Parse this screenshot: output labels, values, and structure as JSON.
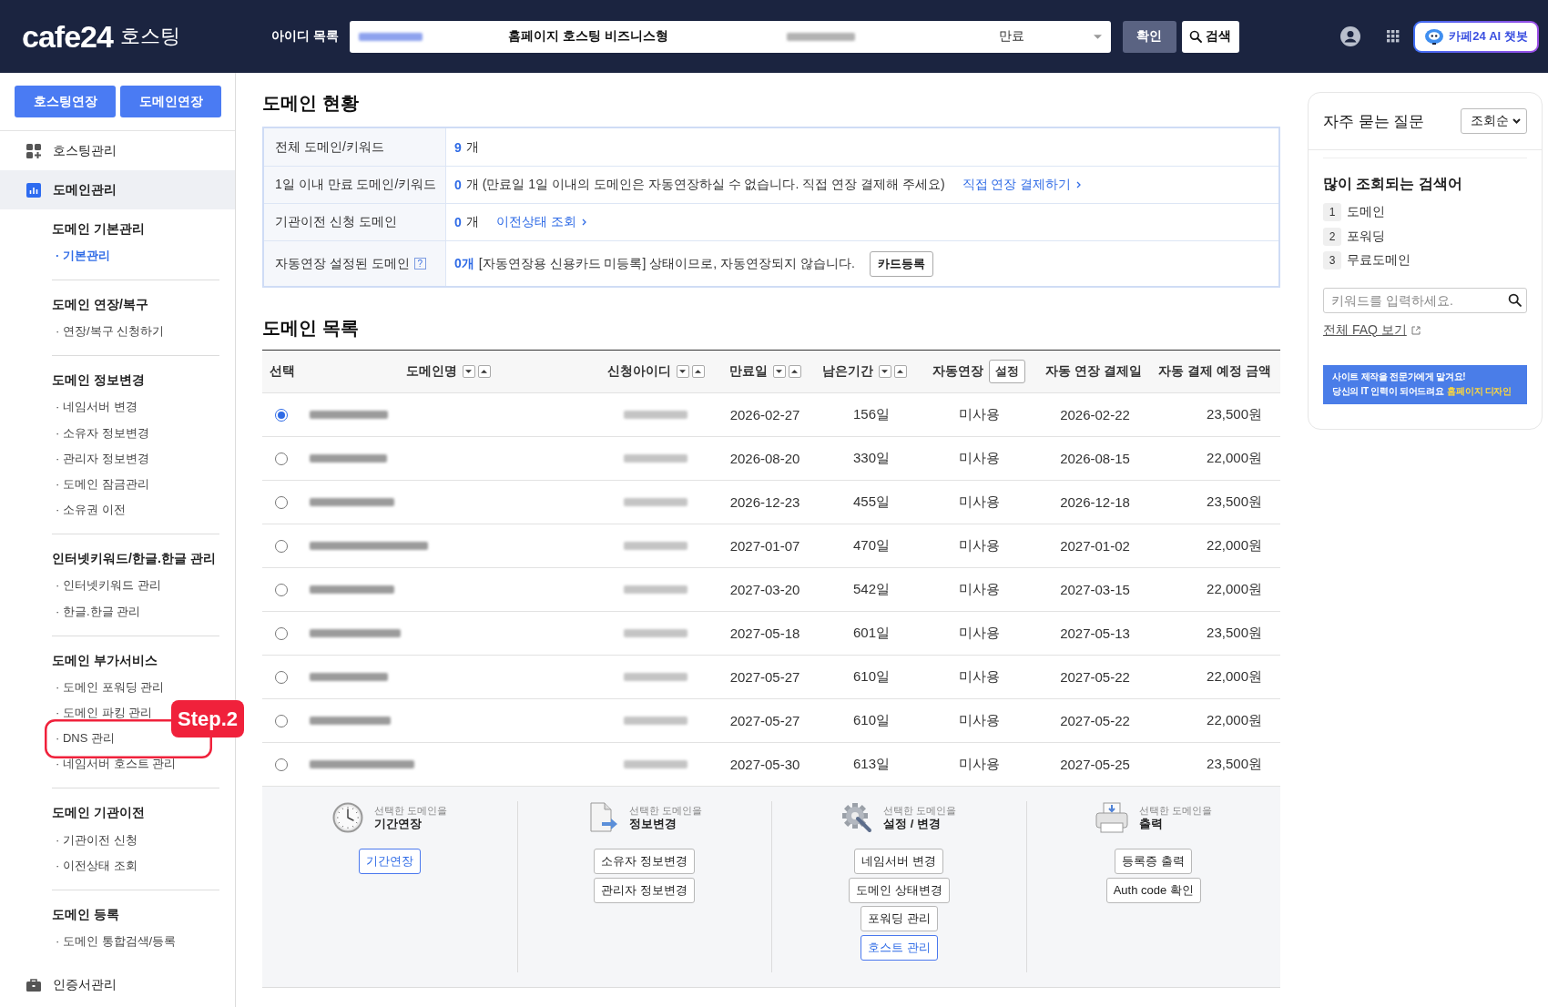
{
  "header": {
    "logo": "cafe24",
    "logo_suffix": "호스팅",
    "account_label": "아이디 목록",
    "account_select": {
      "product": "홈페이지 호스팅 비즈니스형",
      "status": "만료"
    },
    "confirm_button": "확인",
    "search_button": "검색",
    "chatbot_button": "카페24 AI 챗봇"
  },
  "sidebar": {
    "buttons": [
      "호스팅연장",
      "도메인연장"
    ],
    "menu": [
      {
        "label": "호스팅관리",
        "selected": false
      },
      {
        "label": "도메인관리",
        "selected": true,
        "groups": [
          {
            "title": "도메인 기본관리",
            "items": [
              {
                "label": "· 기본관리",
                "selected": true
              }
            ]
          },
          {
            "title": "도메인 연장/복구",
            "items": [
              {
                "label": "· 연장/복구 신청하기",
                "selected": false
              }
            ]
          },
          {
            "title": "도메인 정보변경",
            "items": [
              {
                "label": "· 네임서버 변경",
                "selected": false
              },
              {
                "label": "· 소유자 정보변경",
                "selected": false
              },
              {
                "label": "· 관리자 정보변경",
                "selected": false
              },
              {
                "label": "· 도메인 잠금관리",
                "selected": false
              },
              {
                "label": "· 소유권 이전",
                "selected": false
              }
            ]
          },
          {
            "title": "인터넷키워드/한글.한글 관리",
            "items": [
              {
                "label": "· 인터넷키워드 관리",
                "selected": false
              },
              {
                "label": "· 한글.한글 관리",
                "selected": false
              }
            ]
          },
          {
            "title": "도메인 부가서비스",
            "items": [
              {
                "label": "· 도메인 포워딩 관리",
                "selected": false
              },
              {
                "label": "· 도메인 파킹 관리",
                "selected": false
              },
              {
                "label": "· DNS 관리",
                "selected": false,
                "annotation": "Step.2"
              },
              {
                "label": "· 네임서버 호스트 관리",
                "selected": false
              }
            ]
          },
          {
            "title": "도메인 기관이전",
            "items": [
              {
                "label": "· 기관이전 신청",
                "selected": false
              },
              {
                "label": "· 이전상태 조회",
                "selected": false
              }
            ]
          },
          {
            "title": "도메인 등록",
            "items": [
              {
                "label": "· 도메인 통합검색/등록",
                "selected": false
              }
            ]
          }
        ]
      },
      {
        "label": "인증서관리",
        "selected": false
      }
    ]
  },
  "status": {
    "title": "도메인 현황",
    "rows": [
      {
        "label": "전체 도메인/키워드",
        "count": "9",
        "text": "개"
      },
      {
        "label": "1일 이내 만료 도메인/키워드",
        "count": "0",
        "text": "개 (만료일 1일 이내의 도메인은 자동연장하실 수 없습니다. 직접 연장 결제해 주세요)",
        "link": "직접 연장 결제하기"
      },
      {
        "label": "기관이전 신청 도메인",
        "count": "0",
        "text": "개",
        "link": "이전상태 조회"
      },
      {
        "label": "자동연장 설정된 도메인",
        "help": "?",
        "count": "0개",
        "text": "[자동연장용 신용카드 미등록] 상태이므로, 자동연장되지 않습니다.",
        "button": "카드등록"
      }
    ]
  },
  "domains": {
    "title": "도메인 목록",
    "columns": [
      {
        "label": "선택",
        "sortable": false
      },
      {
        "label": "도메인명",
        "sortable": true
      },
      {
        "label": "신청아이디",
        "sortable": true
      },
      {
        "label": "만료일",
        "sortable": true
      },
      {
        "label": "남은기간",
        "sortable": true
      },
      {
        "label": "자동연장",
        "sortable": false,
        "button": "설정"
      },
      {
        "label": "자동 연장 결제일",
        "sortable": false
      },
      {
        "label": "자동 결제 예정 금액",
        "sortable": false
      }
    ],
    "rows": [
      {
        "selected": true,
        "expires": "2026-02-27",
        "remaining": "156일",
        "auto_renew": "미사용",
        "payment_date": "2026-02-22",
        "amount": "23,500원"
      },
      {
        "selected": false,
        "expires": "2026-08-20",
        "remaining": "330일",
        "auto_renew": "미사용",
        "payment_date": "2026-08-15",
        "amount": "22,000원"
      },
      {
        "selected": false,
        "expires": "2026-12-23",
        "remaining": "455일",
        "auto_renew": "미사용",
        "payment_date": "2026-12-18",
        "amount": "23,500원"
      },
      {
        "selected": false,
        "expires": "2027-01-07",
        "remaining": "470일",
        "auto_renew": "미사용",
        "payment_date": "2027-01-02",
        "amount": "22,000원"
      },
      {
        "selected": false,
        "expires": "2027-03-20",
        "remaining": "542일",
        "auto_renew": "미사용",
        "payment_date": "2027-03-15",
        "amount": "22,000원"
      },
      {
        "selected": false,
        "expires": "2027-05-18",
        "remaining": "601일",
        "auto_renew": "미사용",
        "payment_date": "2027-05-13",
        "amount": "23,500원"
      },
      {
        "selected": false,
        "expires": "2027-05-27",
        "remaining": "610일",
        "auto_renew": "미사용",
        "payment_date": "2027-05-22",
        "amount": "22,000원"
      },
      {
        "selected": false,
        "expires": "2027-05-27",
        "remaining": "610일",
        "auto_renew": "미사용",
        "payment_date": "2027-05-22",
        "amount": "22,000원"
      },
      {
        "selected": false,
        "expires": "2027-05-30",
        "remaining": "613일",
        "auto_renew": "미사용",
        "payment_date": "2027-05-25",
        "amount": "23,500원"
      }
    ]
  },
  "actions": [
    {
      "caption": "선택한 도메인을",
      "title": "기간연장",
      "buttons": [
        {
          "label": "기간연장",
          "highlighted": true
        }
      ]
    },
    {
      "caption": "선택한 도메인을",
      "title": "정보변경",
      "buttons": [
        {
          "label": "소유자 정보변경",
          "highlighted": false
        },
        {
          "label": "관리자 정보변경",
          "highlighted": false
        }
      ]
    },
    {
      "caption": "선택한 도메인을",
      "title": "설정 / 변경",
      "buttons": [
        {
          "label": "네임서버 변경",
          "highlighted": false
        },
        {
          "label": "도메인 상태변경",
          "highlighted": false
        },
        {
          "label": "포워딩 관리",
          "highlighted": false
        },
        {
          "label": "호스트 관리",
          "highlighted": true
        }
      ]
    },
    {
      "caption": "선택한 도메인을",
      "title": "출력",
      "buttons": [
        {
          "label": "등록증 출력",
          "highlighted": false
        },
        {
          "label": "Auth code 확인",
          "highlighted": false
        }
      ]
    }
  ],
  "faq": {
    "title": "자주 묻는 질문",
    "sort": "조회순",
    "popular_title": "많이 조회되는 검색어",
    "popular": [
      {
        "rank": "1",
        "term": "도메인"
      },
      {
        "rank": "2",
        "term": "포워딩"
      },
      {
        "rank": "3",
        "term": "무료도메인"
      }
    ],
    "search_placeholder": "키워드를 입력하세요.",
    "all_link": "전체 FAQ 보기",
    "banner": {
      "line1": "사이트 제작을 전문가에게 맡겨요!",
      "line2": "당신의 IT 인력이 되어드려요",
      "highlight": "홈페이지 디자인"
    }
  }
}
